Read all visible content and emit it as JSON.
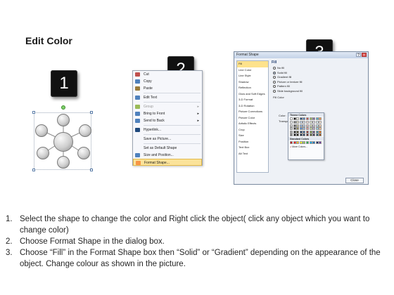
{
  "title": "Edit Color",
  "badges": [
    "1",
    "2",
    "3"
  ],
  "context_menu": {
    "items": [
      {
        "label": "Cut",
        "icon": "scissors-icon",
        "color": "#c0504d"
      },
      {
        "label": "Copy",
        "icon": "copy-icon",
        "color": "#4f81bd"
      },
      {
        "label": "Paste",
        "icon": "paste-icon",
        "color": "#9a7b3b"
      },
      {
        "sep": true
      },
      {
        "label": "Edit Text",
        "icon": "edit-text-icon",
        "color": "#4f81bd"
      },
      {
        "sep": true
      },
      {
        "label": "Group",
        "icon": "group-icon",
        "color": "#9bbb59",
        "submenu": true,
        "disabled": true
      },
      {
        "label": "Bring to Front",
        "icon": "bring-front-icon",
        "color": "#4f81bd",
        "submenu": true
      },
      {
        "label": "Send to Back",
        "icon": "send-back-icon",
        "color": "#4f81bd",
        "submenu": true
      },
      {
        "sep": true
      },
      {
        "label": "Hyperlink...",
        "icon": "hyperlink-icon",
        "color": "#1f497d"
      },
      {
        "sep": true
      },
      {
        "label": "Save as Picture...",
        "icon": "",
        "color": ""
      },
      {
        "sep": true
      },
      {
        "label": "Set as Default Shape",
        "icon": "",
        "color": ""
      },
      {
        "label": "Size and Position...",
        "icon": "size-icon",
        "color": "#4f81bd"
      },
      {
        "label": "Format Shape...",
        "icon": "format-icon",
        "color": "#f79646",
        "highlight": true
      }
    ]
  },
  "dialog": {
    "title": "Format Shape",
    "sidebar": [
      "Fill",
      "Line Color",
      "Line Style",
      "Shadow",
      "Reflection",
      "Glow and Soft Edges",
      "3-D Format",
      "3-D Rotation",
      "Picture Corrections",
      "Picture Color",
      "Artistic Effects",
      "Crop",
      "Size",
      "Position",
      "Text Box",
      "Alt Text"
    ],
    "fill_heading": "Fill",
    "options": [
      {
        "label": "No fill",
        "checked": false
      },
      {
        "label": "Solid fill",
        "checked": true
      },
      {
        "label": "Gradient fill",
        "checked": false
      },
      {
        "label": "Picture or texture fill",
        "checked": false
      },
      {
        "label": "Pattern fill",
        "checked": false
      },
      {
        "label": "Slide background fill",
        "checked": false
      }
    ],
    "fill_color_label": "Fill Color",
    "color_label": "Color:",
    "transparency_label": "Transpa",
    "close_label": "Close"
  },
  "palette": {
    "theme_label": "Theme Colors",
    "standard_label": "Standard Colors",
    "more_label": "More Colors...",
    "theme_top": [
      "#ffffff",
      "#000000",
      "#eeece1",
      "#1f497d",
      "#4f81bd",
      "#c0504d",
      "#9bbb59",
      "#8064a2",
      "#4bacc6",
      "#f79646"
    ],
    "theme_rows": [
      [
        "#f2f2f2",
        "#7f7f7f",
        "#ddd9c3",
        "#c6d9f0",
        "#dbe5f1",
        "#f2dcdb",
        "#ebf1dd",
        "#e5e0ec",
        "#dbeef3",
        "#fdeada"
      ],
      [
        "#d8d8d8",
        "#595959",
        "#c4bd97",
        "#8db3e2",
        "#b8cce4",
        "#e5b9b7",
        "#d7e3bc",
        "#ccc1d9",
        "#b7dde8",
        "#fbd5b5"
      ],
      [
        "#bfbfbf",
        "#3f3f3f",
        "#938953",
        "#548dd4",
        "#95b3d7",
        "#d99694",
        "#c3d69b",
        "#b2a2c7",
        "#92cddc",
        "#fac08f"
      ],
      [
        "#a5a5a5",
        "#262626",
        "#494429",
        "#17365d",
        "#366092",
        "#953734",
        "#76923c",
        "#5f497a",
        "#31859b",
        "#e36c09"
      ],
      [
        "#7f7f7f",
        "#0c0c0c",
        "#1d1b10",
        "#0f243e",
        "#244061",
        "#632423",
        "#4f6128",
        "#3f3151",
        "#205867",
        "#974806"
      ]
    ],
    "standard": [
      "#c00000",
      "#ff0000",
      "#ffc000",
      "#ffff00",
      "#92d050",
      "#00b050",
      "#00b0f0",
      "#0070c0",
      "#002060",
      "#7030a0"
    ]
  },
  "instructions": [
    {
      "num": "1.",
      "text": "Select the shape to change the color and Right click the object( click any object which you want to change color)"
    },
    {
      "num": "2.",
      "text": "Choose Format Shape in the dialog box."
    },
    {
      "num": "3.",
      "text": "Choose “Fill” in the Format Shape box then “Solid” or “Gradient” depending on the appearance of the object. Change colour as shown in the picture."
    }
  ]
}
